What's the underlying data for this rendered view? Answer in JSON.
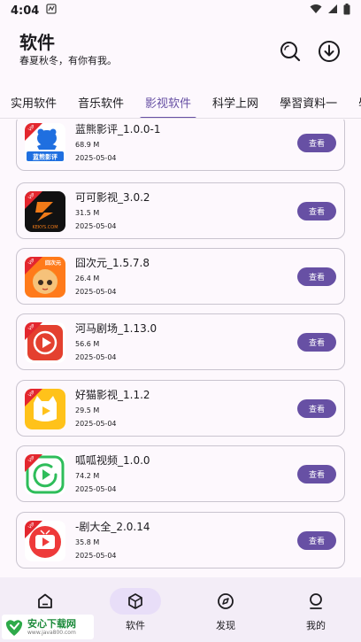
{
  "status_bar": {
    "time": "4:04"
  },
  "header": {
    "title": "软件",
    "subtitle": "春夏秋冬，有你有我。"
  },
  "tabs": [
    {
      "label": "实用软件",
      "active": false
    },
    {
      "label": "音乐软件",
      "active": false
    },
    {
      "label": "影视软件",
      "active": true
    },
    {
      "label": "科学上网",
      "active": false
    },
    {
      "label": "學習資料一",
      "active": false
    },
    {
      "label": "學",
      "active": false
    }
  ],
  "apps": [
    {
      "name": "蓝熊影评_1.0.0-1",
      "size": "68.9 M",
      "date": "2025-05-04",
      "button": "查看",
      "icon": "blue-bear-icon",
      "icon_text": "蓝熊影评"
    },
    {
      "name": "可可影视_3.0.2",
      "size": "31.5 M",
      "date": "2025-05-04",
      "button": "查看",
      "icon": "keke-icon",
      "icon_text": "KEKYS.COM"
    },
    {
      "name": "囧次元_1.5.7.8",
      "size": "26.4 M",
      "date": "2025-05-04",
      "button": "查看",
      "icon": "jiong-anime-icon",
      "icon_text": "囧次元"
    },
    {
      "name": "河马剧场_1.13.0",
      "size": "56.6 M",
      "date": "2025-05-04",
      "button": "查看",
      "icon": "hippo-play-icon",
      "icon_text": ""
    },
    {
      "name": "好猫影视_1.1.2",
      "size": "29.5 M",
      "date": "2025-05-04",
      "button": "查看",
      "icon": "cat-play-icon",
      "icon_text": ""
    },
    {
      "name": "呱呱视频_1.0.0",
      "size": "74.2 M",
      "date": "2025-05-04",
      "button": "查看",
      "icon": "green-play-icon",
      "icon_text": ""
    },
    {
      "name": "-剧大全_2.0.14",
      "size": "35.8 M",
      "date": "2025-05-04",
      "button": "查看",
      "icon": "red-tv-icon",
      "icon_text": ""
    }
  ],
  "vip_badge": "VIP",
  "bottom_nav": [
    {
      "label": "",
      "icon": "home-icon",
      "active": false
    },
    {
      "label": "软件",
      "icon": "cube-icon",
      "active": true
    },
    {
      "label": "发现",
      "icon": "compass-icon",
      "active": false
    },
    {
      "label": "我的",
      "icon": "person-icon",
      "active": false
    }
  ],
  "watermark": {
    "main": "安心下载网",
    "sub": "www.java800.com"
  },
  "colors": {
    "accent": "#6750a4",
    "pill": "#e8def8",
    "nav_bg": "#f3edf7"
  }
}
